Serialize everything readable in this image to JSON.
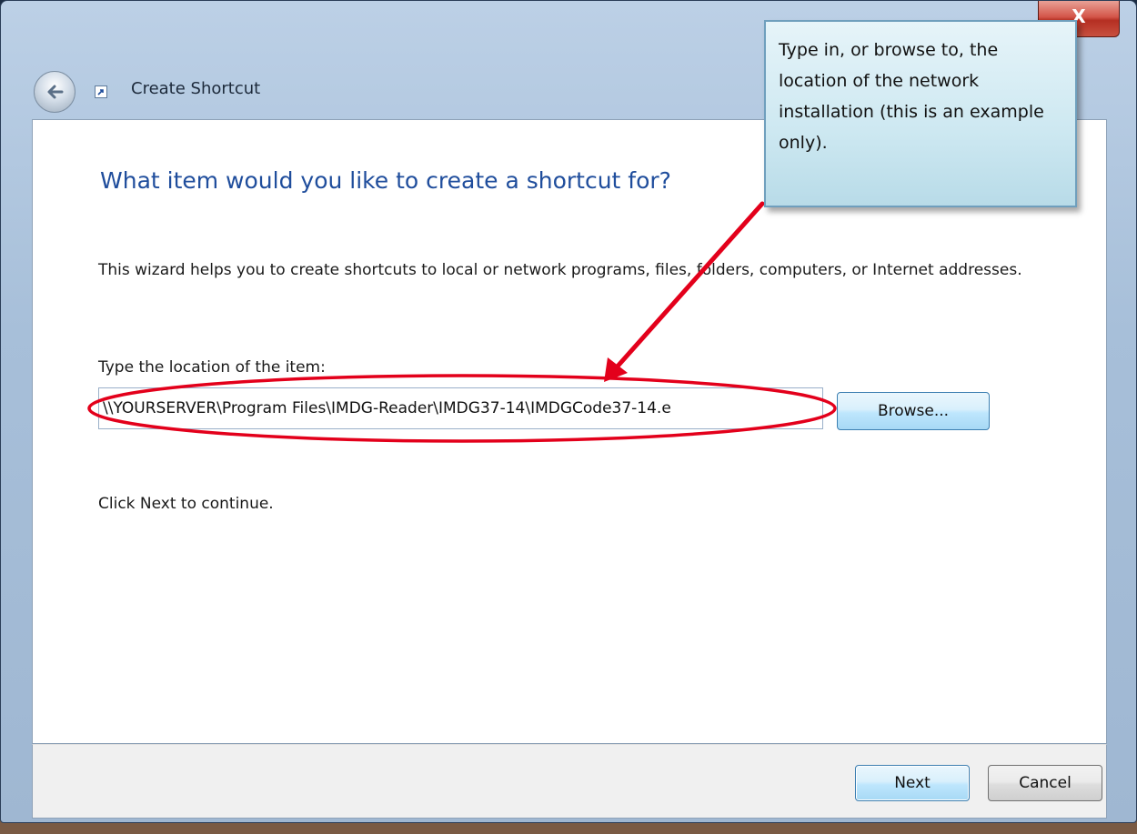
{
  "window": {
    "title": "Create Shortcut",
    "close_glyph": "X"
  },
  "content": {
    "heading": "What item would you like to create a shortcut for?",
    "intro": "This wizard helps you to create shortcuts to local or network programs, files, folders, computers, or Internet addresses.",
    "location_label": "Type the location of the item:",
    "location_value": "\\\\YOURSERVER\\Program Files\\IMDG-Reader\\IMDG37-14\\IMDGCode37-14.e",
    "browse_label": "Browse...",
    "continue_text": "Click Next to continue."
  },
  "footer": {
    "next_label": "Next",
    "cancel_label": "Cancel"
  },
  "callout": {
    "text": "Type in, or browse to, the location of the network installation (this is an example only)."
  },
  "icons": {
    "back": "back-arrow-icon",
    "title": "shortcut-icon"
  },
  "colors": {
    "heading": "#1f4d9c",
    "annotation": "#e3001b",
    "callout_bg": "#cde8f1"
  }
}
